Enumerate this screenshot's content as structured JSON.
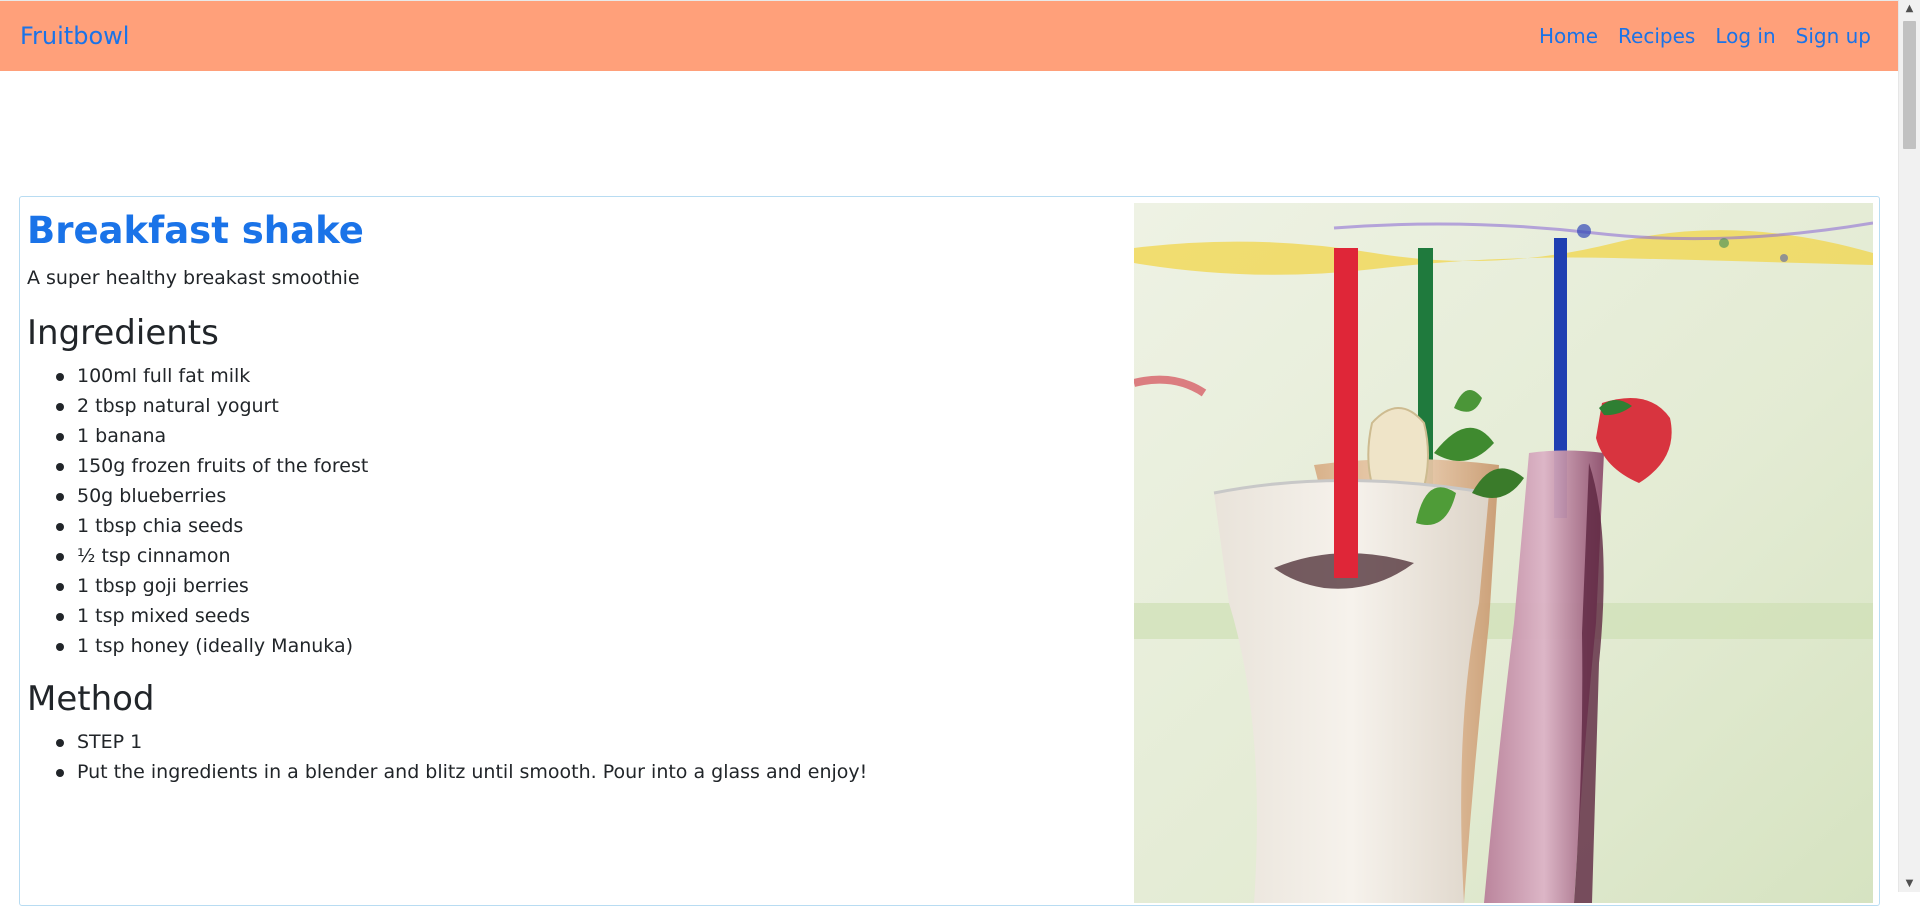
{
  "nav": {
    "brand": "Fruitbowl",
    "links": [
      "Home",
      "Recipes",
      "Log in",
      "Sign up"
    ]
  },
  "recipe": {
    "title": "Breakfast shake",
    "subtitle": "A super healthy breakast smoothie",
    "ingredients_heading": "Ingredients",
    "ingredients": [
      "100ml full fat milk",
      "2 tbsp natural yogurt",
      "1 banana",
      "150g frozen fruits of the forest",
      "50g blueberries",
      "1 tbsp chia seeds",
      "½ tsp cinnamon",
      "1 tbsp goji berries",
      "1 tsp mixed seeds",
      "1 tsp honey (ideally Manuka)"
    ],
    "method_heading": "Method",
    "method": [
      "STEP 1",
      "Put the ingredients in a blender and blitz until smooth. Pour into a glass and enjoy!"
    ]
  },
  "icons": {
    "scroll_up": "scroll-up-arrow-icon",
    "scroll_down": "scroll-down-arrow-icon"
  },
  "colors": {
    "navbar": "#ffa07a",
    "link": "#1a73e8",
    "card_border": "#b8dcf2"
  }
}
